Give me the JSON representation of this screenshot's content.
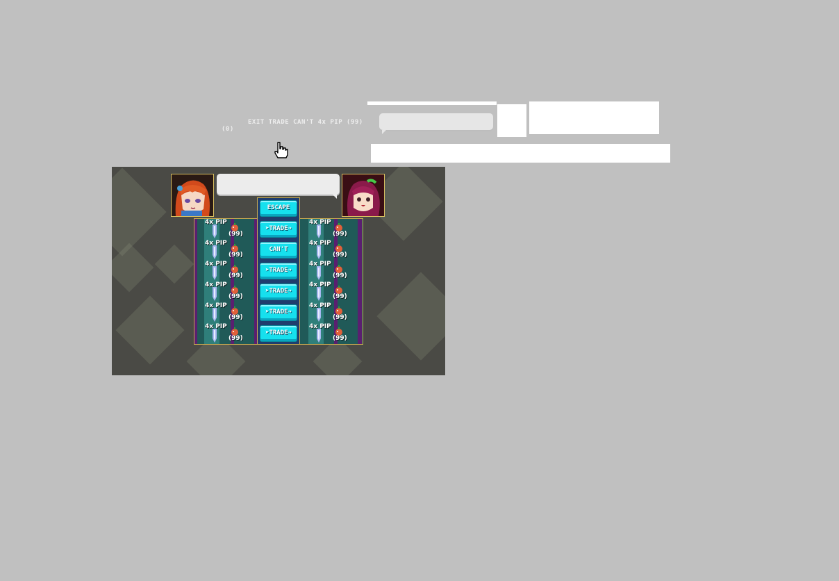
{
  "atlas": {
    "labels": "EXIT TRADE CAN'T 4x PIP (99)",
    "zero_count": "(0)",
    "hand_icon": "pointer-hand-icon"
  },
  "trade_screen": {
    "top_button": "ESCAPE",
    "rows": [
      {
        "left_offer": "4x PIP",
        "left_count": "(99)",
        "action": "➤TRADE➔",
        "right_offer": "4x PIP",
        "right_count": "(99)"
      },
      {
        "left_offer": "4x PIP",
        "left_count": "(99)",
        "action": "CAN'T",
        "right_offer": "4x PIP",
        "right_count": "(99)"
      },
      {
        "left_offer": "4x PIP",
        "left_count": "(99)",
        "action": "➤TRADE➔",
        "right_offer": "4x PIP",
        "right_count": "(99)"
      },
      {
        "left_offer": "4x PIP",
        "left_count": "(99)",
        "action": "➤TRADE➔",
        "right_offer": "4x PIP",
        "right_count": "(99)"
      },
      {
        "left_offer": "4x PIP",
        "left_count": "(99)",
        "action": "➤TRADE➔",
        "right_offer": "4x PIP",
        "right_count": "(99)"
      },
      {
        "left_offer": "4x PIP",
        "left_count": "(99)",
        "action": "➤TRADE➔",
        "right_offer": "4x PIP",
        "right_count": "(99)"
      }
    ],
    "icons": {
      "item": "crystal-icon",
      "currency": "fruit-icon"
    }
  },
  "colors": {
    "background": "#c0c0c0",
    "panel": "#205a58",
    "button": "#16e0ee",
    "border": "#c8aa50"
  }
}
